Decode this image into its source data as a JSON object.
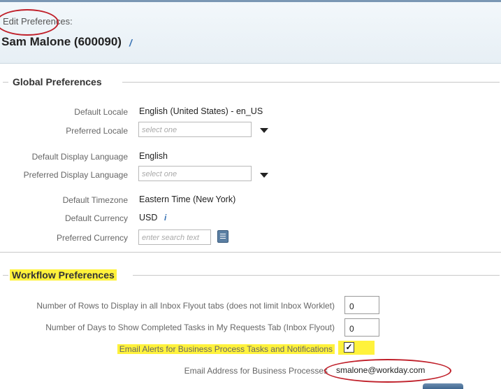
{
  "header": {
    "edit_label": "Edit Preferences:",
    "worker_name": "Sam Malone (600090)",
    "edit_icon": "pencil-icon"
  },
  "global": {
    "title": "Global Preferences",
    "default_locale_label": "Default Locale",
    "default_locale_value": "English (United States) - en_US",
    "preferred_locale_label": "Preferred Locale",
    "preferred_locale_placeholder": "select one",
    "default_display_language_label": "Default Display Language",
    "default_display_language_value": "English",
    "preferred_display_language_label": "Preferred Display Language",
    "preferred_display_language_placeholder": "select one",
    "default_timezone_label": "Default Timezone",
    "default_timezone_value": "Eastern Time (New York)",
    "default_currency_label": "Default Currency",
    "default_currency_value": "USD",
    "preferred_currency_label": "Preferred Currency",
    "preferred_currency_placeholder": "enter search text"
  },
  "workflow": {
    "title": "Workflow Preferences",
    "rows_label": "Number of Rows to Display in all Inbox Flyout tabs (does not limit Inbox Worklet)",
    "rows_value": "0",
    "days_label": "Number of Days to Show Completed Tasks in My Requests Tab (Inbox Flyout)",
    "days_value": "0",
    "email_alerts_label": "Email Alerts for Business Process Tasks and Notifications",
    "email_alerts_checked": true,
    "email_address_label": "Email Address for Business Processes",
    "email_address_value": "smalone@workday.com"
  },
  "colors": {
    "highlight": "#fff23c",
    "annotation": "#c0202a",
    "link": "#3a74b5"
  }
}
